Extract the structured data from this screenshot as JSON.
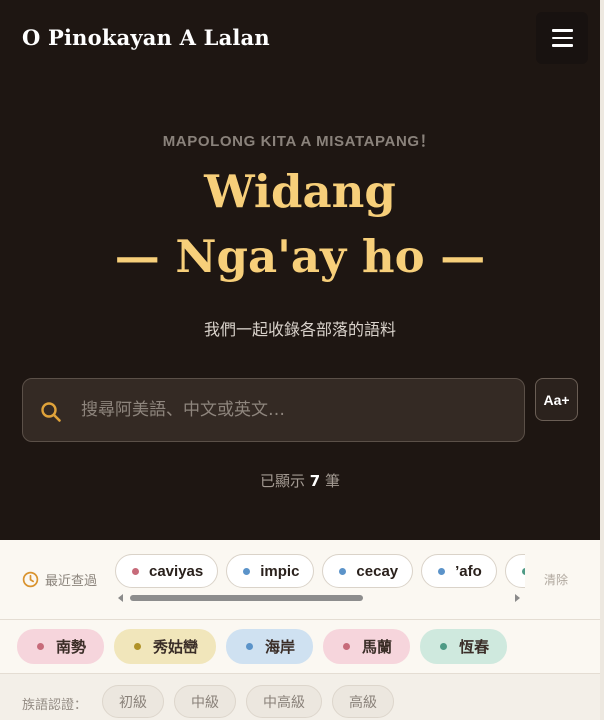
{
  "header": {
    "app_title": "O Pinokayan A Lalan",
    "menu_icon": "hamburger-menu-icon"
  },
  "hero": {
    "tagline": "MAPOLONG KITA A MISATAPANG！",
    "headline_line1": "Widang",
    "headline_line2": "— Nga'ay ho —",
    "subtitle": "我們一起收錄各部落的語料"
  },
  "search": {
    "placeholder": "搜尋阿美語、中文或英文…",
    "value": "",
    "icon": "search-icon",
    "icon_color": "#e0a33a"
  },
  "font_size_button": {
    "label": "Aa+"
  },
  "results": {
    "prefix": "已顯示",
    "count": "7",
    "suffix": "筆"
  },
  "recent": {
    "label": "最近查過",
    "icon": "clock-icon",
    "clear_label": "清除",
    "items": [
      {
        "word": "caviyas",
        "dot_color": "#c76b7a"
      },
      {
        "word": "impic",
        "dot_color": "#5b93c9"
      },
      {
        "word": "cecay",
        "dot_color": "#5b93c9"
      },
      {
        "word": "’afo",
        "dot_color": "#5b93c9"
      },
      {
        "word": "’",
        "dot_color": "#4e9a85"
      }
    ]
  },
  "regions": [
    {
      "label": "南勢",
      "bg": "#f6d5dc",
      "dot_color": "#c76b7a"
    },
    {
      "label": "秀姑巒",
      "bg": "#f1e6bb",
      "dot_color": "#b09228"
    },
    {
      "label": "海岸",
      "bg": "#cfe1f1",
      "dot_color": "#5b93c9"
    },
    {
      "label": "馬蘭",
      "bg": "#f6d5dc",
      "dot_color": "#c76b7a"
    },
    {
      "label": "恆春",
      "bg": "#cfe9de",
      "dot_color": "#4e9a85"
    }
  ],
  "levels": {
    "label": "族語認證：",
    "items": [
      "初級",
      "中級",
      "中高級",
      "高級"
    ]
  },
  "colors": {
    "hero_bg": "#1e1612",
    "accent_gold": "#f7cf7a"
  }
}
